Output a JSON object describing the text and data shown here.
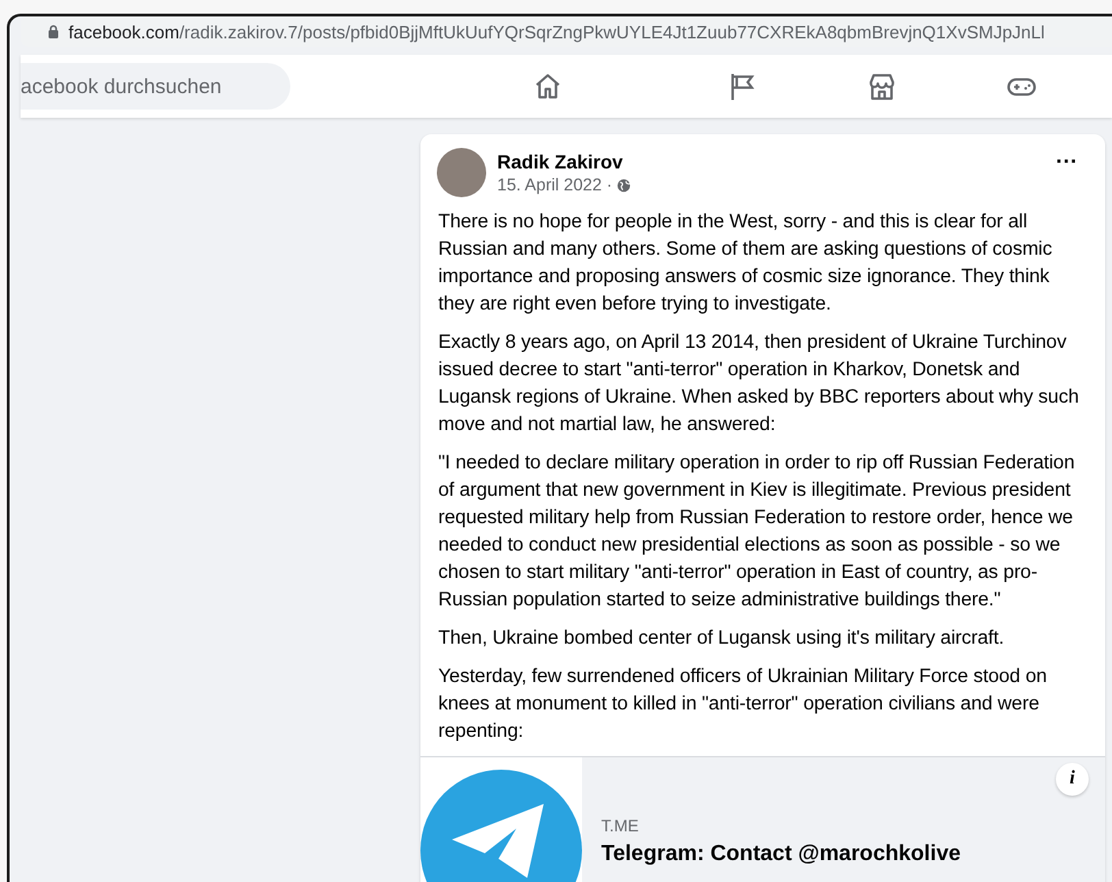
{
  "address_bar": {
    "domain": "facebook.com",
    "path": "/radik.zakirov.7/posts/pfbid0BjjMftUkUufYQrSqrZngPkwUYLE4Jt1Zuub77CXREkA8qbmBrevjnQ1XvSMJpJnLl"
  },
  "search": {
    "placeholder": "acebook durchsuchen"
  },
  "nav_icons": [
    {
      "kind": "home"
    },
    {
      "kind": "flag"
    },
    {
      "kind": "store"
    },
    {
      "kind": "gamepad"
    }
  ],
  "post": {
    "author": "Radik Zakirov",
    "date": "15. April 2022 ·",
    "menu": "···",
    "paragraphs": [
      "There is no hope for people in the West, sorry - and this is clear for all Russian and many others. Some of them are asking questions of cosmic importance and proposing answers of cosmic size ignorance. They think they are right even before trying to investigate.",
      "Exactly 8 years ago, on April 13 2014, then president of Ukraine Turchinov issued decree to start \"anti-terror\" operation in Kharkov, Donetsk and Lugansk regions of Ukraine. When asked by BBC reporters about why such move and not martial law, he answered:",
      "\"I needed to declare military operation in order to rip off Russian Federation of argument that new government in Kiev is illegitimate. Previous president requested military help from Russian Federation to restore order, hence we needed to conduct new presidential elections as soon as possible - so we chosen to start military \"anti-terror\" operation in East of country, as pro-Russian population started to seize administrative buildings there.\"",
      "Then, Ukraine bombed center of Lugansk using it's military aircraft.",
      "Yesterday, few surrendened officers of Ukrainian Military Force stood on knees at monument to killed in \"anti-terror\" operation civilians and were repenting:"
    ],
    "link_preview": {
      "domain": "T.ME",
      "title": "Telegram: Contact @marochkolive",
      "info": "i"
    }
  }
}
